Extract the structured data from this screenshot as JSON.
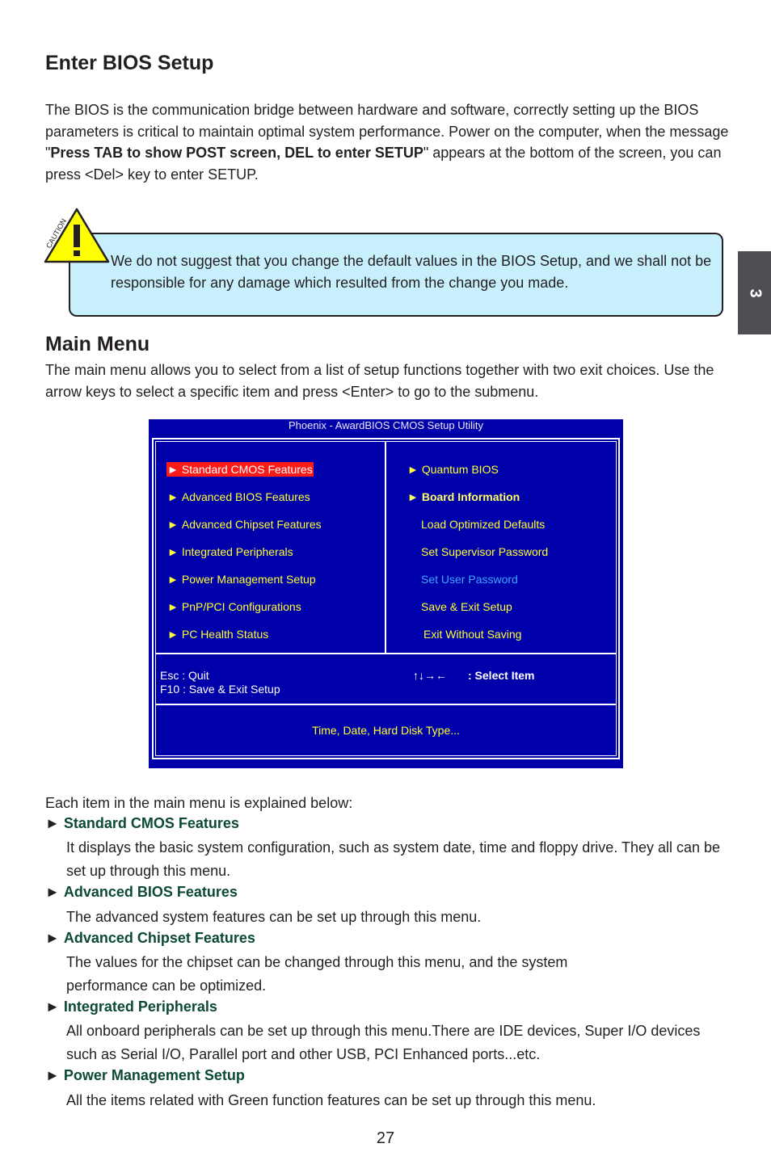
{
  "chapter_tab": "3",
  "section1": {
    "title": "Enter BIOS Setup",
    "para_before": "The BIOS is the communication bridge between hardware and software, correctly setting up the BIOS parameters is critical to maintain optimal system performance. Power on the computer, when the message \"",
    "para_bold": "Press TAB to show POST screen, DEL to enter SETUP",
    "para_after": "\" appears at the bottom of the screen, you can press <Del> key to enter SETUP."
  },
  "caution": {
    "label": "CAUTION",
    "icon": "warning-triangle-icon",
    "text": "We do not suggest that you change the default values in the BIOS Setup, and we shall not be responsible for any damage which resulted from the change you made."
  },
  "section2": {
    "title": "Main Menu",
    "para": "The main menu allows you to select from a list of setup functions together with two exit choices. Use the arrow keys to select a specific item and press <Enter> to go to the submenu."
  },
  "bios": {
    "title": "Phoenix - AwardBIOS CMOS Setup Utility",
    "colors": {
      "background": "#0000aa",
      "item": "#ffff33",
      "selected_bg": "#ff1a1a",
      "highlight_blue": "#3fa8ff"
    },
    "left_items": [
      {
        "label": "Standard CMOS Features",
        "arrow": "►",
        "selected": true
      },
      {
        "label": "Advanced BIOS Features",
        "arrow": "►"
      },
      {
        "label": "Advanced Chipset Features",
        "arrow": "►"
      },
      {
        "label": "Integrated Peripherals",
        "arrow": "►"
      },
      {
        "label": "Power Management Setup",
        "arrow": "►"
      },
      {
        "label": "PnP/PCI Configurations",
        "arrow": "►"
      },
      {
        "label": "PC Health Status",
        "arrow": "►"
      }
    ],
    "right_items": [
      {
        "label": "Quantum BIOS",
        "arrow": "►"
      },
      {
        "label": "Board Information",
        "arrow": "►"
      },
      {
        "label": "Load Optimized Defaults"
      },
      {
        "label": "Set Supervisor Password"
      },
      {
        "label": "Set User Password"
      },
      {
        "label": "Save & Exit Setup"
      },
      {
        "label": "Exit Without Saving"
      }
    ],
    "keys": {
      "esc": "Esc : Quit",
      "f10": "F10 : Save & Exit Setup",
      "arrows": "↑↓→←",
      "select": ": Select Item"
    },
    "help": "Time, Date, Hard Disk Type..."
  },
  "explanations": {
    "intro": "Each item in the main menu is explained below:",
    "arrow": "►",
    "items": [
      {
        "title": "Standard CMOS Features",
        "body": "It displays the basic system configuration, such as system date, time and floppy drive. They all can be set up through this menu."
      },
      {
        "title": "Advanced BIOS Features",
        "body": "The advanced system features can be set up through this menu."
      },
      {
        "title": "Advanced Chipset Features",
        "body": "The values for the chipset can be changed through this menu, and the system performance can be optimized."
      },
      {
        "title": "Integrated Peripherals",
        "body": "All onboard peripherals can be set up through this menu.There are IDE devices, Super I/O devices such as Serial I/O, Parallel port and other USB, PCI Enhanced ports...etc."
      },
      {
        "title": "Power Management Setup",
        "body": "All the items related with Green function features can be set up through this menu."
      }
    ]
  },
  "page_number": "27"
}
